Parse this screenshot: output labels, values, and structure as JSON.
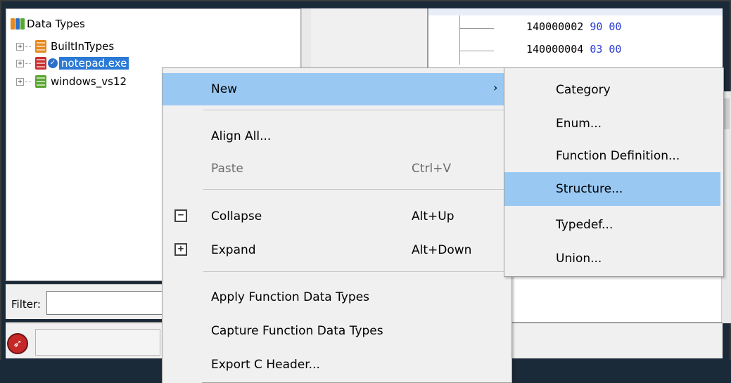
{
  "tree": {
    "root_label": "Data Types",
    "items": [
      {
        "label": "BuiltInTypes",
        "expander": "+",
        "book_color": "orange",
        "selected": false
      },
      {
        "label": "notepad.exe",
        "expander": "+",
        "book_color": "red",
        "selected": true
      },
      {
        "label": "windows_vs12",
        "expander": "+",
        "book_color": "green",
        "selected": false
      }
    ]
  },
  "listing": {
    "rows": [
      {
        "address": "140000002",
        "bytes": "90 00"
      },
      {
        "address": "140000004",
        "bytes": "03 00"
      }
    ]
  },
  "filter": {
    "label": "Filter:",
    "value": ""
  },
  "context_menu": {
    "new": {
      "label": "New",
      "arrow": "›"
    },
    "align_all": {
      "label": "Align All..."
    },
    "paste": {
      "label": "Paste",
      "accel": "Ctrl+V"
    },
    "collapse": {
      "label": "Collapse",
      "accel": "Alt+Up",
      "icon": "−"
    },
    "expand": {
      "label": "Expand",
      "accel": "Alt+Down",
      "icon": "+"
    },
    "apply_function_data_types": {
      "label": "Apply Function Data Types"
    },
    "capture_function_data_types": {
      "label": "Capture Function Data Types"
    },
    "export_c_header": {
      "label": "Export C Header..."
    }
  },
  "submenu": {
    "items": [
      {
        "label": "Category"
      },
      {
        "label": "Enum..."
      },
      {
        "label": "Function Definition..."
      },
      {
        "label": "Structure..."
      },
      {
        "label": "Typedef..."
      },
      {
        "label": "Union..."
      }
    ]
  },
  "colors": {
    "selection": "#2b7ad6",
    "menu_highlight": "#99c9f3",
    "byte_text": "#2a3bd1"
  }
}
